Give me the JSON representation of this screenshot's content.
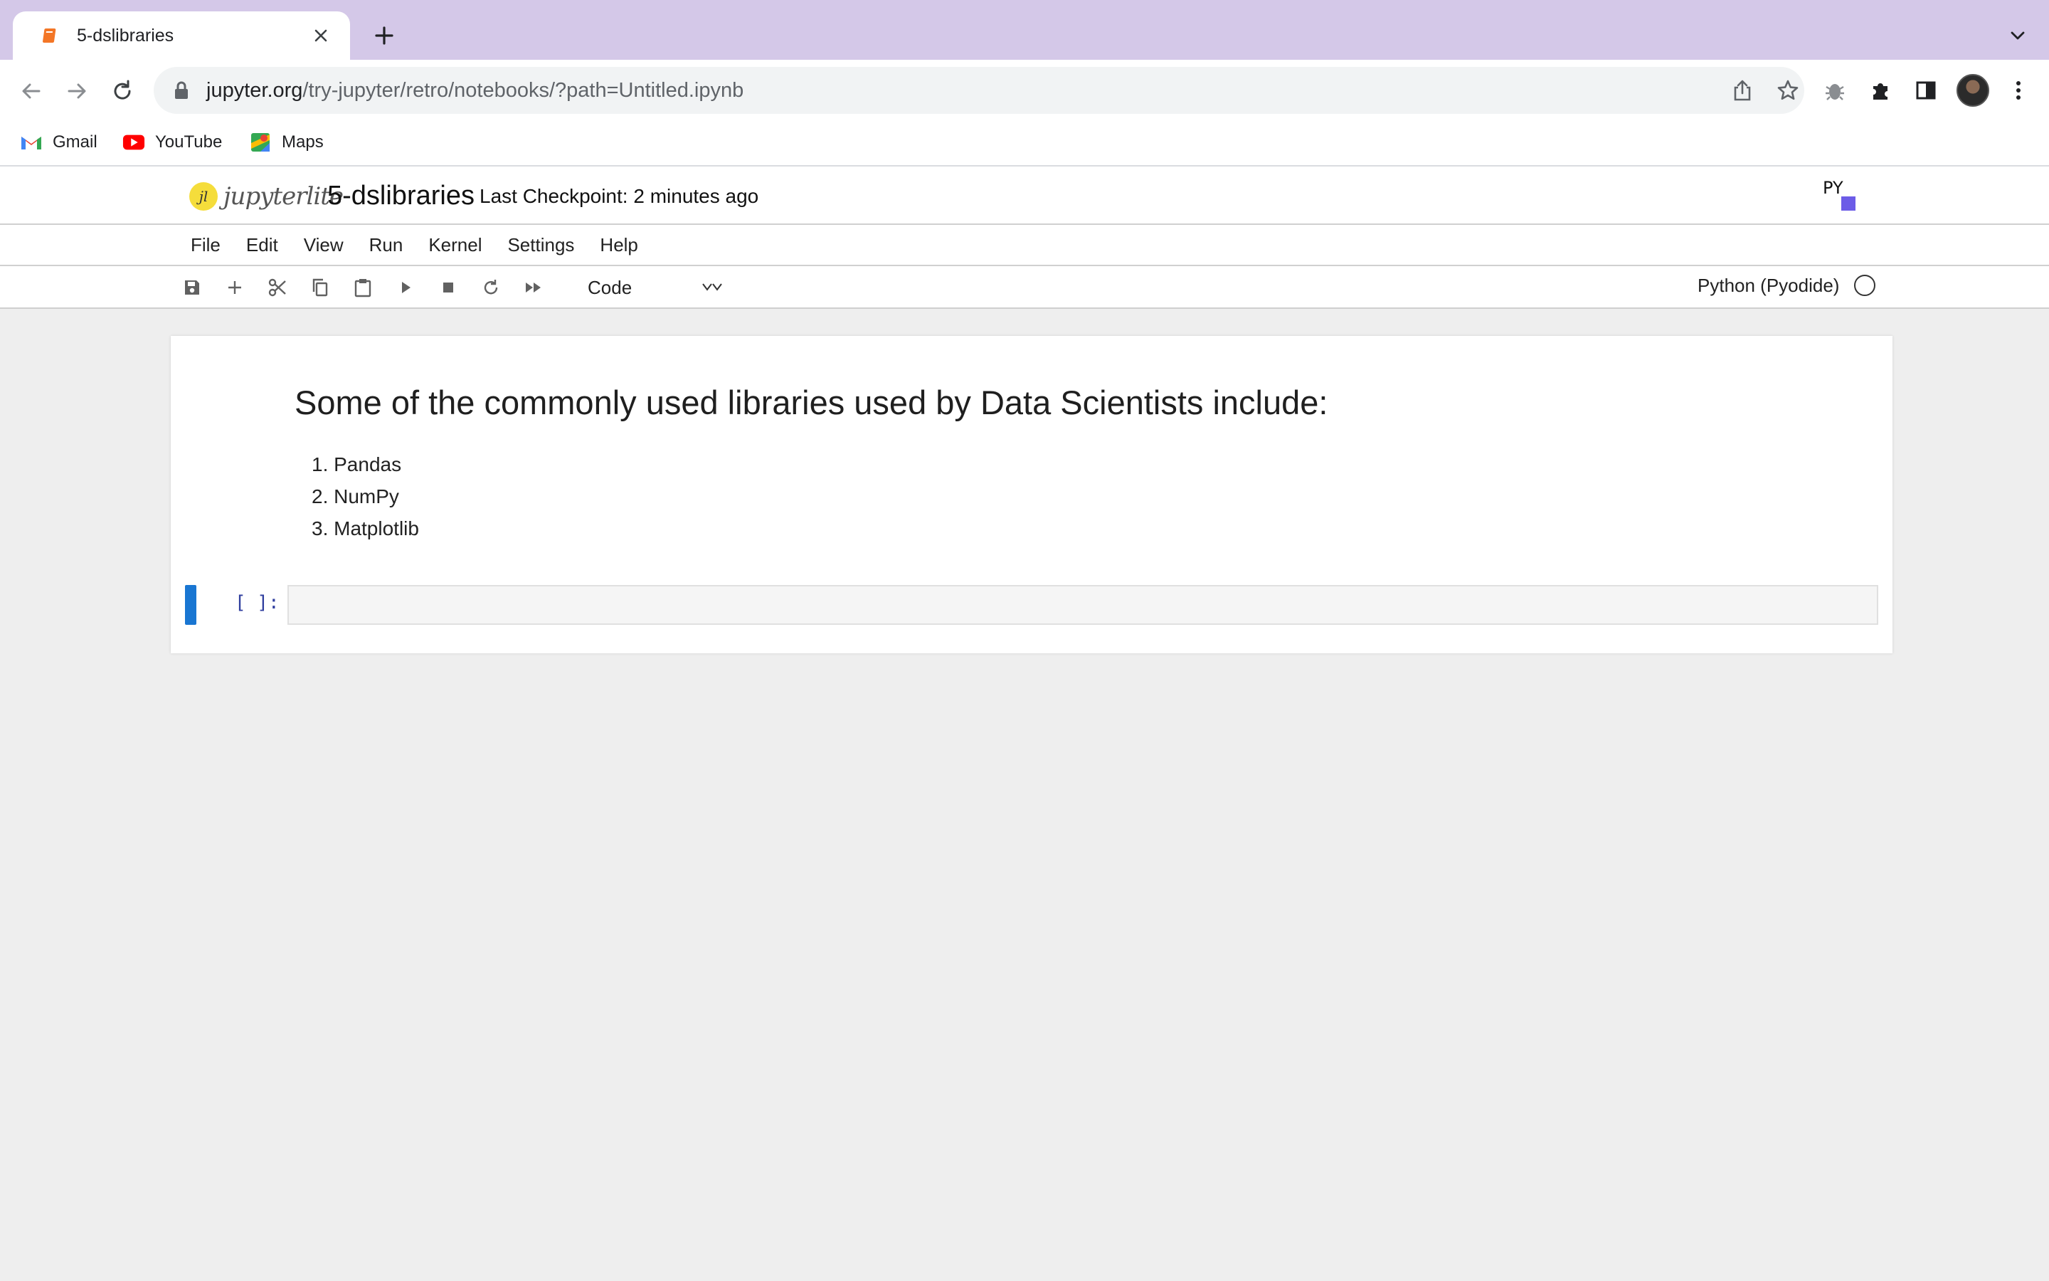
{
  "browser": {
    "tab": {
      "title": "5-dslibraries"
    },
    "url": {
      "host": "jupyter.org",
      "path": "/try-jupyter/retro/notebooks/?path=Untitled.ipynb"
    },
    "bookmarks": [
      {
        "label": "Gmail",
        "icon": "gmail-icon"
      },
      {
        "label": "YouTube",
        "icon": "youtube-icon"
      },
      {
        "label": "Maps",
        "icon": "maps-icon"
      }
    ]
  },
  "jupyter": {
    "logo_text": "jupyterlite",
    "logo_badge": "jl",
    "notebook_title": "5-dslibraries",
    "checkpoint": "Last Checkpoint: 2 minutes ago",
    "kernel_logo": "PY",
    "menu": [
      "File",
      "Edit",
      "View",
      "Run",
      "Kernel",
      "Settings",
      "Help"
    ],
    "cell_type": "Code",
    "kernel": "Python (Pyodide)"
  },
  "notebook": {
    "heading": "Some of the commonly used libraries used by Data Scientists include:",
    "list": [
      "1. Pandas",
      "2. NumPy",
      "3. Matplotlib"
    ],
    "code_prompt": "[ ]:",
    "code_value": ""
  },
  "colors": {
    "tabstrip": "#d4c8e8",
    "accent": "#1976d2",
    "prompt": "#303f9f"
  }
}
